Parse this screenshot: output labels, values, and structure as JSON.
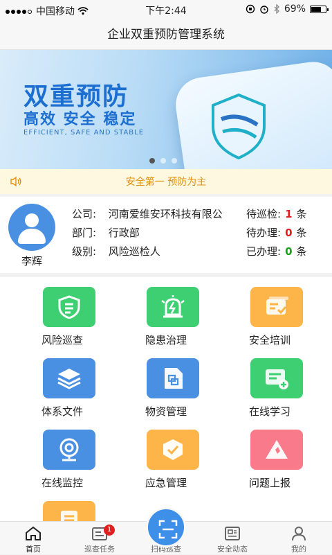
{
  "status_bar": {
    "carrier": "中国移动",
    "time": "下午2:44",
    "battery": "69%",
    "battery_level": 0.69
  },
  "header": {
    "title": "企业双重预防管理系统"
  },
  "banner": {
    "title": "双重预防",
    "subtitle": "高效 安全 稳定",
    "english": "EFFICIENT, SAFE AND STABLE",
    "page_count": 3,
    "active_page": 0
  },
  "notice": {
    "text": "安全第一 预防为主"
  },
  "profile": {
    "name": "李辉",
    "company_label": "公司:",
    "company": "河南爱维安环科技有限公",
    "dept_label": "部门:",
    "dept": "行政部",
    "level_label": "级别:",
    "level": "风险巡检人",
    "tasks": [
      {
        "label": "待巡检:",
        "count": "1",
        "unit": "条",
        "color": "red"
      },
      {
        "label": "待办理:",
        "count": "0",
        "unit": "条",
        "color": "red"
      },
      {
        "label": "已办理:",
        "count": "0",
        "unit": "条",
        "color": "green"
      }
    ]
  },
  "menu": [
    {
      "label": "风险巡查",
      "icon": "shield-list-icon",
      "color": "#3ecf72"
    },
    {
      "label": "隐患治理",
      "icon": "alarm-light-icon",
      "color": "#3ecf72"
    },
    {
      "label": "安全培训",
      "icon": "training-card-icon",
      "color": "#fdb549"
    },
    {
      "label": "体系文件",
      "icon": "layers-icon",
      "color": "#4a90e2"
    },
    {
      "label": "物资管理",
      "icon": "document-box-icon",
      "color": "#4a90e2"
    },
    {
      "label": "在线学习",
      "icon": "add-card-icon",
      "color": "#3ecf72"
    },
    {
      "label": "在线监控",
      "icon": "camera-icon",
      "color": "#4a90e2"
    },
    {
      "label": "应急管理",
      "icon": "check-badge-icon",
      "color": "#fdb549"
    },
    {
      "label": "问题上报",
      "icon": "warning-triangle-icon",
      "color": "#f97b8b"
    },
    {
      "label": "",
      "icon": "list-card-icon",
      "color": "#fdb549"
    }
  ],
  "tabbar": {
    "tabs": [
      {
        "label": "首页",
        "icon": "home-icon"
      },
      {
        "label": "巡查任务",
        "icon": "task-card-icon",
        "badge": "1"
      },
      {
        "label": "扫码巡查",
        "icon": "scan-icon"
      },
      {
        "label": "安全动态",
        "icon": "news-icon"
      },
      {
        "label": "我的",
        "icon": "user-icon"
      }
    ]
  }
}
